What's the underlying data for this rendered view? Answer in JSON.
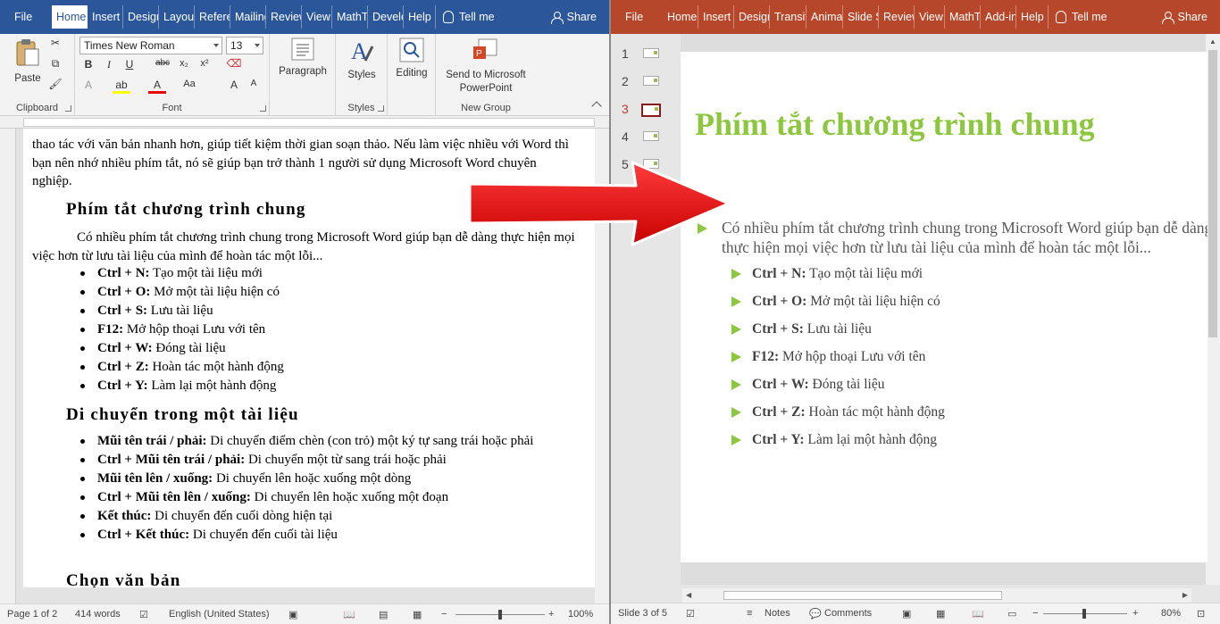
{
  "word": {
    "tabs": [
      "File",
      "Home",
      "Insert",
      "Design",
      "Layout",
      "References",
      "Mailings",
      "Review",
      "View",
      "MathType",
      "Developer",
      "Help"
    ],
    "tell_me": "Tell me",
    "share": "Share",
    "ribbon": {
      "paste": "Paste",
      "clipboard": "Clipboard",
      "font_name": "Times New Roman",
      "font_size": "13",
      "font": "Font",
      "paragraph": "Paragraph",
      "styles_btn": "Styles",
      "styles": "Styles",
      "editing": "Editing",
      "send_line1": "Send to Microsoft",
      "send_line2": "PowerPoint",
      "new_group": "New Group"
    },
    "doc": {
      "intro": "thao tác với văn bản nhanh hơn, giúp tiết kiệm thời gian soạn thảo. Nếu làm việc nhiều với Word thì bạn nên nhớ nhiều phím tắt, nó sẽ giúp bạn trở thành 1 người sử dụng Microsoft Word chuyên nghiệp.",
      "h1": "Phím tắt chương trình chung",
      "p1": "Có nhiều phím tắt chương trình chung trong Microsoft Word giúp bạn dễ dàng thực hiện mọi việc hơn từ lưu tài liệu của mình để hoàn tác một lỗi...",
      "list1": [
        {
          "key": "Ctrl + N:",
          "text": " Tạo một tài liệu mới"
        },
        {
          "key": "Ctrl + O:",
          "text": " Mở một tài liệu hiện có"
        },
        {
          "key": "Ctrl + S:",
          "text": " Lưu tài liệu"
        },
        {
          "key": "F12:",
          "text": " Mở hộp thoại Lưu với tên"
        },
        {
          "key": "Ctrl + W:",
          "text": " Đóng tài liệu"
        },
        {
          "key": "Ctrl + Z:",
          "text": " Hoàn tác một hành động"
        },
        {
          "key": "Ctrl + Y:",
          "text": " Làm lại một hành động"
        }
      ],
      "h2": "Di chuyển trong một tài liệu",
      "list2": [
        {
          "key": "Mũi tên trái / phải:",
          "text": " Di chuyển điểm chèn (con trỏ) một ký tự sang trái hoặc phải"
        },
        {
          "key": "Ctrl + Mũi tên trái / phải:",
          "text": " Di chuyển một từ sang trái hoặc phải"
        },
        {
          "key": "Mũi tên lên / xuống:",
          "text": " Di chuyển lên hoặc xuống một dòng"
        },
        {
          "key": "Ctrl + Mũi tên lên / xuống:",
          "text": " Di chuyển lên hoặc xuống một đoạn"
        },
        {
          "key": "Kết thúc:",
          "text": " Di chuyển đến cuối dòng hiện tại"
        },
        {
          "key": "Ctrl + Kết thúc:",
          "text": " Di chuyển đến cuối tài liệu"
        }
      ],
      "h3": "Chọn văn bản"
    },
    "status": {
      "page": "Page 1 of 2",
      "words": "414 words",
      "language": "English (United States)",
      "zoom": "100%"
    }
  },
  "ppt": {
    "tabs": [
      "File",
      "Home",
      "Insert",
      "Design",
      "Transitions",
      "Animations",
      "Slide Show",
      "Review",
      "View",
      "MathType",
      "Add-ins",
      "Help"
    ],
    "tell_me": "Tell me",
    "share": "Share",
    "slide_numbers": [
      "1",
      "2",
      "3",
      "4",
      "5"
    ],
    "selected_slide": 3,
    "slide": {
      "title": "Phím tắt chương trình chung",
      "body": "Có nhiều phím tắt chương trình chung trong Microsoft Word giúp bạn dễ dàng thực hiện mọi việc hơn từ lưu tài liệu của mình để hoàn tác một lỗi...",
      "bullets": [
        {
          "key": "Ctrl + N:",
          "text": "  Tạo một tài liệu mới"
        },
        {
          "key": "Ctrl + O:",
          "text": " Mở một tài liệu hiện có"
        },
        {
          "key": "Ctrl + S:",
          "text": " Lưu tài liệu"
        },
        {
          "key": "F12:",
          "text": " Mở hộp thoại Lưu với tên"
        },
        {
          "key": "Ctrl + W:",
          "text": " Đóng tài liệu"
        },
        {
          "key": "Ctrl + Z:",
          "text": " Hoàn tác một hành động"
        },
        {
          "key": "Ctrl + Y:",
          "text": "  Làm lại một hành động"
        }
      ]
    },
    "status": {
      "slide": "Slide 3 of 5",
      "notes": "Notes",
      "comments": "Comments",
      "zoom": "80%"
    }
  },
  "colors": {
    "word_accent": "#2b579a",
    "ppt_accent": "#b7472a",
    "title_green": "#8dc63f",
    "arrow_red": "#e8141b"
  }
}
